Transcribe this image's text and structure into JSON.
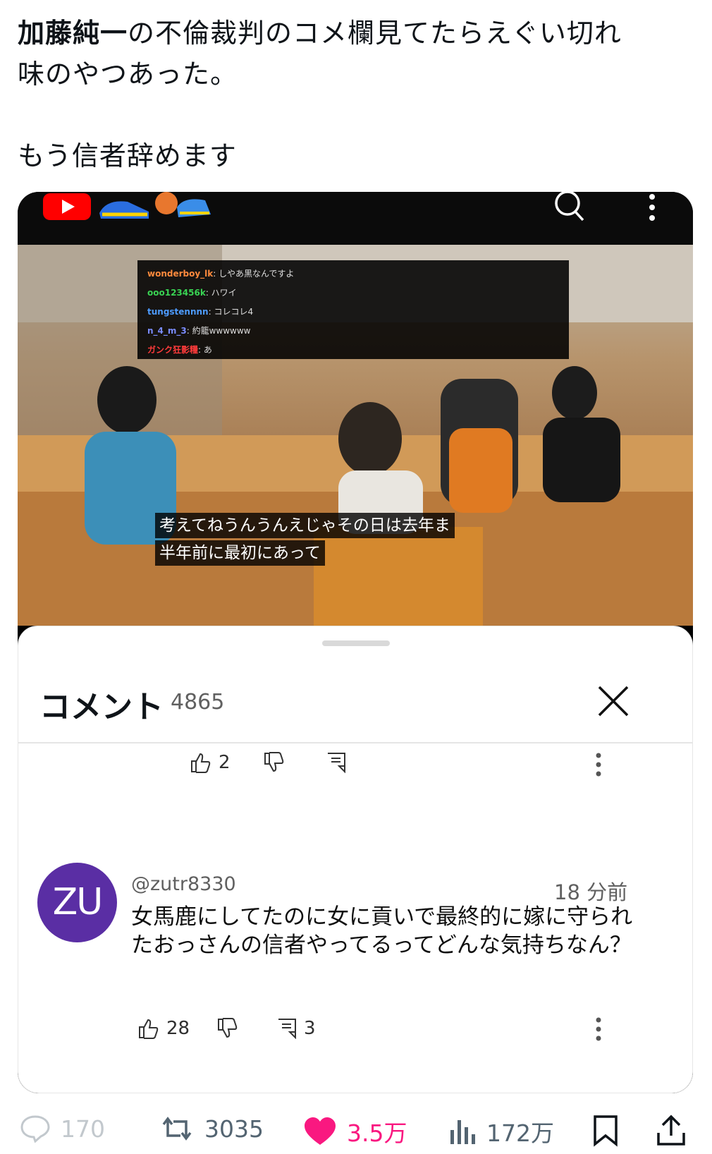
{
  "post": {
    "line1_bold": "加藤純一",
    "line1_rest": "の不倫裁判のコメ欄見てたらえぐい切れ",
    "line2": "味のやつあった。",
    "line3": "もう信者辞めます"
  },
  "video": {
    "chat": [
      {
        "user": "wonderboy_lk",
        "msg": "しやあ黒なんですよ",
        "color": "#ff8a3d"
      },
      {
        "user": "ooo123456k",
        "msg": "ハワイ",
        "color": "#39d353"
      },
      {
        "user": "tungstennnn",
        "msg": "コレコレ4",
        "color": "#4d9bff"
      },
      {
        "user": "n_4_m_3",
        "msg": "約籠wwwwww",
        "color": "#7a8cff"
      },
      {
        "user": "ガンク狂影糧",
        "msg": "あ",
        "color": "#ff3b3b"
      }
    ],
    "caption1": "考えてねうんうんえじゃその日は去年ま",
    "caption2": "半年前に最初にあって"
  },
  "comments": {
    "title": "コメント",
    "count": "4865",
    "prev_likes": "2",
    "comment": {
      "avatar_initials": "ZU",
      "user": "@zutr8330",
      "time": "18 分前",
      "text": "女馬鹿にしてたのに女に貢いで最終的に嫁に守られたおっさんの信者やってるってどんな気持ちなん？",
      "likes": "28",
      "replies": "3"
    }
  },
  "footer": {
    "replies": "170",
    "reposts": "3035",
    "likes": "3.5万",
    "views": "172万",
    "like_color": "#f91880"
  }
}
